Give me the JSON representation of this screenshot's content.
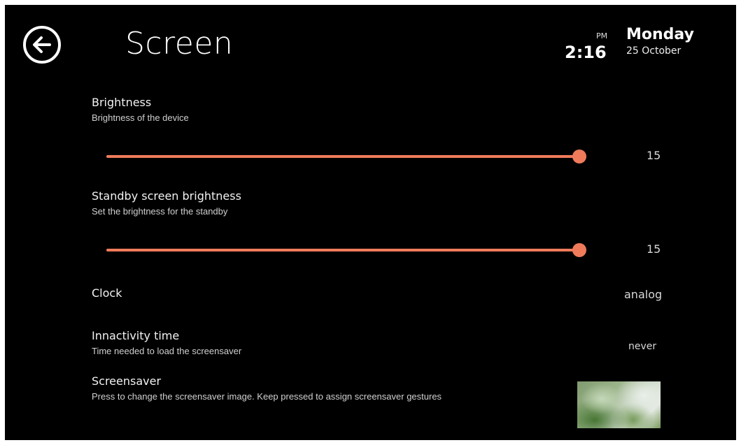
{
  "header": {
    "title": "Screen",
    "ampm": "PM",
    "time": "2:16",
    "day": "Monday",
    "date": "25 October"
  },
  "settings": {
    "brightness": {
      "title": "Brightness",
      "subtitle": "Brightness of the device",
      "value_label": "15",
      "level": 1.0
    },
    "standby_brightness": {
      "title": "Standby screen brightness",
      "subtitle": "Set the brightness for the standby",
      "value_label": "15",
      "level": 1.0
    },
    "clock": {
      "title": "Clock",
      "value": "analog"
    },
    "inactivity": {
      "title": "Innactivity time",
      "subtitle": "Time needed to load the screensaver",
      "value": "never"
    },
    "screensaver": {
      "title": "Screensaver",
      "subtitle": "Press to change the screensaver image. Keep pressed to assign screensaver gestures"
    }
  },
  "colors": {
    "accent": "#ef7b5b",
    "background": "#000000",
    "text": "#ffffff"
  },
  "icons": {
    "back": "back-arrow-circle-icon"
  }
}
